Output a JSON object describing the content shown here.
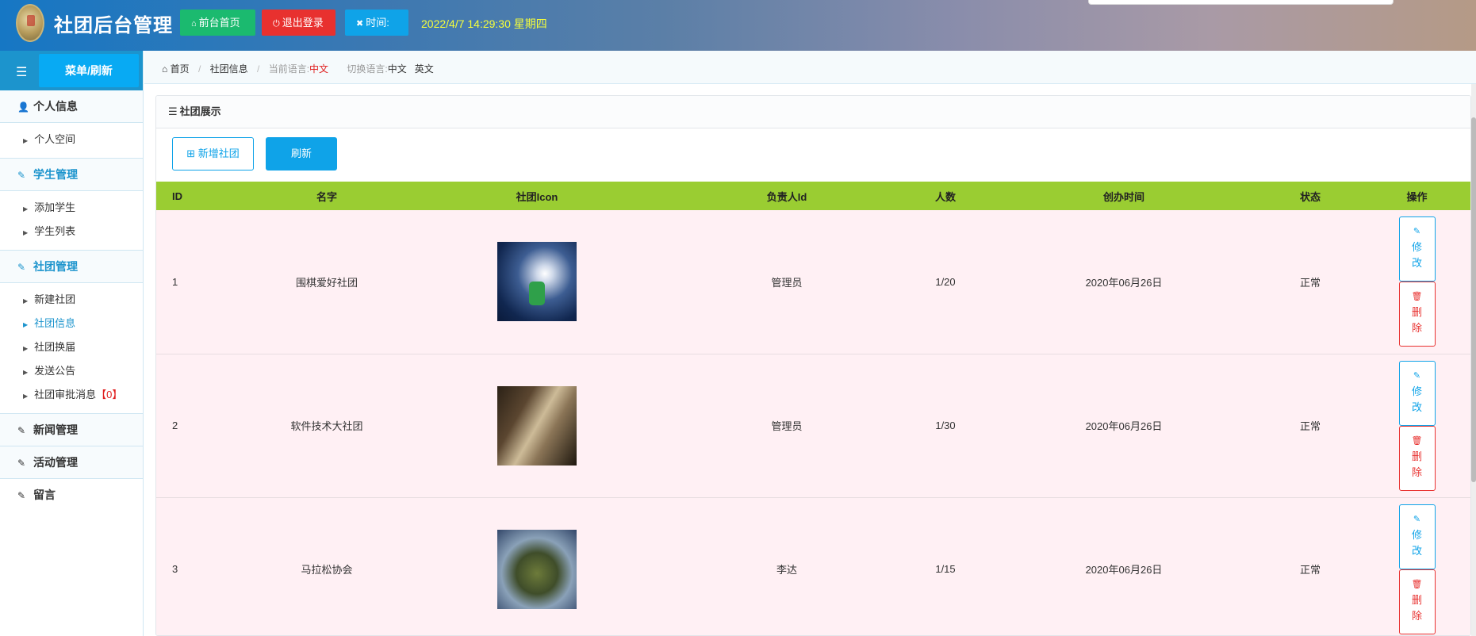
{
  "header": {
    "title": "社团后台管理",
    "front_btn": "前台首页",
    "logout_btn": "退出登录",
    "time_btn": "时间:",
    "clock": "2022/4/7 14:29:30 星期四"
  },
  "sidebar": {
    "menu_btn": "菜单/刷新",
    "groups": [
      {
        "label": "个人信息",
        "items": [
          {
            "label": "个人空间"
          }
        ]
      },
      {
        "label": "学生管理",
        "items": [
          {
            "label": "添加学生"
          },
          {
            "label": "学生列表"
          }
        ]
      },
      {
        "label": "社团管理",
        "items": [
          {
            "label": "新建社团"
          },
          {
            "label": "社团信息"
          },
          {
            "label": "社团换届"
          },
          {
            "label": "发送公告"
          },
          {
            "label": "社团审批消息",
            "badge": "【0】"
          }
        ]
      },
      {
        "label": "新闻管理"
      },
      {
        "label": "活动管理"
      },
      {
        "label": "留言"
      }
    ]
  },
  "breadcrumb": {
    "home": "首页",
    "current": "社团信息",
    "lang_label": "当前语言:",
    "lang_value": "中文",
    "switch_label": "切换语言:",
    "opt_cn": "中文",
    "opt_en": "英文"
  },
  "panel": {
    "title": "社团展示",
    "add_btn": "新增社团",
    "refresh_btn": "刷新"
  },
  "table": {
    "headers": [
      "ID",
      "名字",
      "社团Icon",
      "负责人Id",
      "人数",
      "创办时间",
      "状态",
      "操作"
    ],
    "edit_label": "修改",
    "delete_label": "删除",
    "rows": [
      {
        "id": "1",
        "name": "围棋爱好社团",
        "leader": "管理员",
        "count": "1/20",
        "date": "2020年06月26日",
        "status": "正常"
      },
      {
        "id": "2",
        "name": "软件技术大社团",
        "leader": "管理员",
        "count": "1/30",
        "date": "2020年06月26日",
        "status": "正常"
      },
      {
        "id": "3",
        "name": "马拉松协会",
        "leader": "李达",
        "count": "1/15",
        "date": "2020年06月26日",
        "status": "正常"
      }
    ]
  }
}
